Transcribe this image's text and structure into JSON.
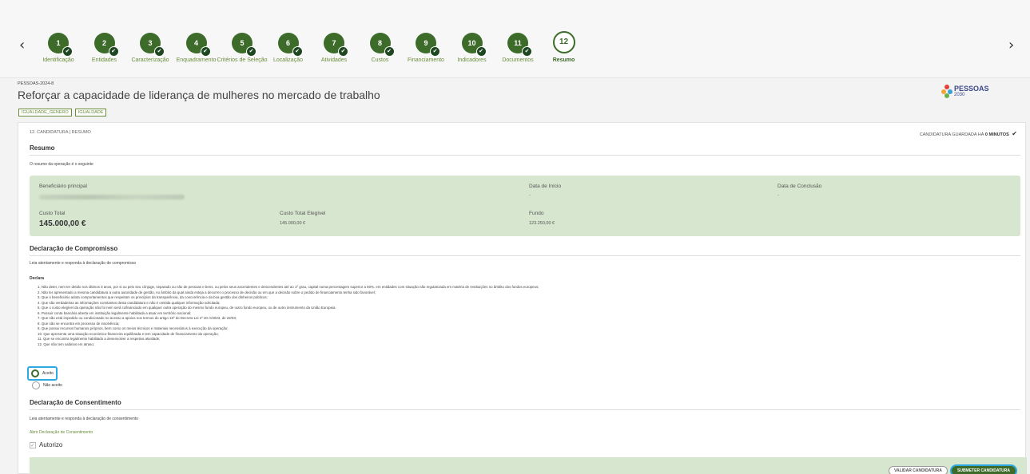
{
  "stepper": {
    "steps": [
      {
        "num": "1",
        "label": "Identificação",
        "done": true
      },
      {
        "num": "2",
        "label": "Entidades",
        "done": true
      },
      {
        "num": "3",
        "label": "Caracterização",
        "done": true
      },
      {
        "num": "4",
        "label": "Enquadramento",
        "done": true
      },
      {
        "num": "5",
        "label": "Critérios de Seleção",
        "done": true
      },
      {
        "num": "6",
        "label": "Localização",
        "done": true
      },
      {
        "num": "7",
        "label": "Atividades",
        "done": true
      },
      {
        "num": "8",
        "label": "Custos",
        "done": true
      },
      {
        "num": "9",
        "label": "Financiamento",
        "done": true
      },
      {
        "num": "10",
        "label": "Indicadores",
        "done": true
      },
      {
        "num": "11",
        "label": "Documentos",
        "done": true
      },
      {
        "num": "12",
        "label": "Resumo",
        "done": false
      }
    ],
    "prev_icon": "‹",
    "next_icon": "›"
  },
  "header": {
    "code": "PESSOAS-2024-8",
    "title": "Reforçar a capacidade de liderança de mulheres no mercado de trabalho",
    "tags": [
      "IGUALDADE_GENERO",
      "IGUALDADE"
    ],
    "logo_name": "PESSOAS",
    "logo_year": "2030"
  },
  "card": {
    "breadcrumb": "12. CANDIDATURA | RESUMO",
    "saved_prefix": "CANDIDATURA GUARDADA HÁ",
    "saved_time": "0 MINUTOS",
    "resumo_title": "Resumo",
    "resumo_intro": "O resumo da operação é o seguinte",
    "summary": {
      "beneficiario_label": "Beneficiário principal",
      "data_inicio_label": "Data de Início",
      "data_inicio_value": "-",
      "data_conclusao_label": "Data de Conclusão",
      "data_conclusao_value": "-",
      "custo_total_label": "Custo Total",
      "custo_total_value": "145.000,00 €",
      "custo_elegivel_label": "Custo Total Elegível",
      "custo_elegivel_value": "145.000,00 €",
      "fundo_label": "Fundo",
      "fundo_value": "123.250,00 €"
    },
    "compromisso_title": "Declaração de Compromisso",
    "compromisso_intro": "Leia atentamente e responda à declaração de compromisso",
    "declara_label": "Declara",
    "declaration_items": [
      "1. Não deter, nem ter detido nos últimos 3 anos, por si ou pelo seu cônjuge, separado ou não de pessoas e bens, ou pelos seus ascendentes e descendentes até ao 1º grau, capital numa percentagem superior a 50%, em entidades com situação não regularizada em matéria de restituições no âmbito dos fundos europeus;",
      "2. Não ter apresentado a mesma candidatura a outra autoridade de gestão, no âmbito da qual ainda esteja a decorrer o processo de decisão ou em que a decisão sobre o pedido de financiamento tenha sido favorável;",
      "3. Que o beneficiário adota comportamentos que respeitam os princípios da transparência, da concorrência e da boa gestão dos dinheiros públicos;",
      "4. Que são verdadeiras as informações constantes desta candidatura e não é omitida qualquer informação solicitada;",
      "5. Que o custo elegível da operação não foi nem será cofinanciado em qualquer outra operação do mesmo fundo europeu, de outro fundo europeu, ou de outro instrumento da União Europeia.",
      "6. Possuir conta bancária aberta em instituição legalmente habilitada a atuar em território nacional;",
      "7. Que não está impedido ou condicionado no acesso a apoios nos termos do artigo 16º do Decreto-Lei nº 20-A/2023, de 22/03;",
      "8. Que não se encontra em processo de insolvência;",
      "9. Que possui recursos humanos próprios, bem como os meios técnicos e materiais necessários à execução da operação;",
      "10. Que apresenta uma situação económico-financeira equilibrada e tem capacidade de financiamento da operação;",
      "11. Que se encontra legalmente habilitado a desenvolver a respetiva atividade;",
      "12. Que não tem salários em atraso;"
    ],
    "accept_label": "Aceito",
    "reject_label": "Não aceito",
    "consentimento_title": "Declaração de Consentimento",
    "consentimento_intro": "Leia atentamente e responda à declaração de consentimento",
    "consentimento_link": "Abrir Declaração de Consentimento",
    "autorizo_label": "Autorizo",
    "validate_button": "VALIDAR CANDIDATURA",
    "submit_button": "SUBMETER CANDIDATURA"
  },
  "colors": {
    "accent": "#3d6b2a",
    "link": "#6a8d3a",
    "summary_bg": "#d7e6cf",
    "focus": "#2ea8e0"
  },
  "icons": {
    "check": "✔",
    "checkbox_tick": "✓"
  }
}
